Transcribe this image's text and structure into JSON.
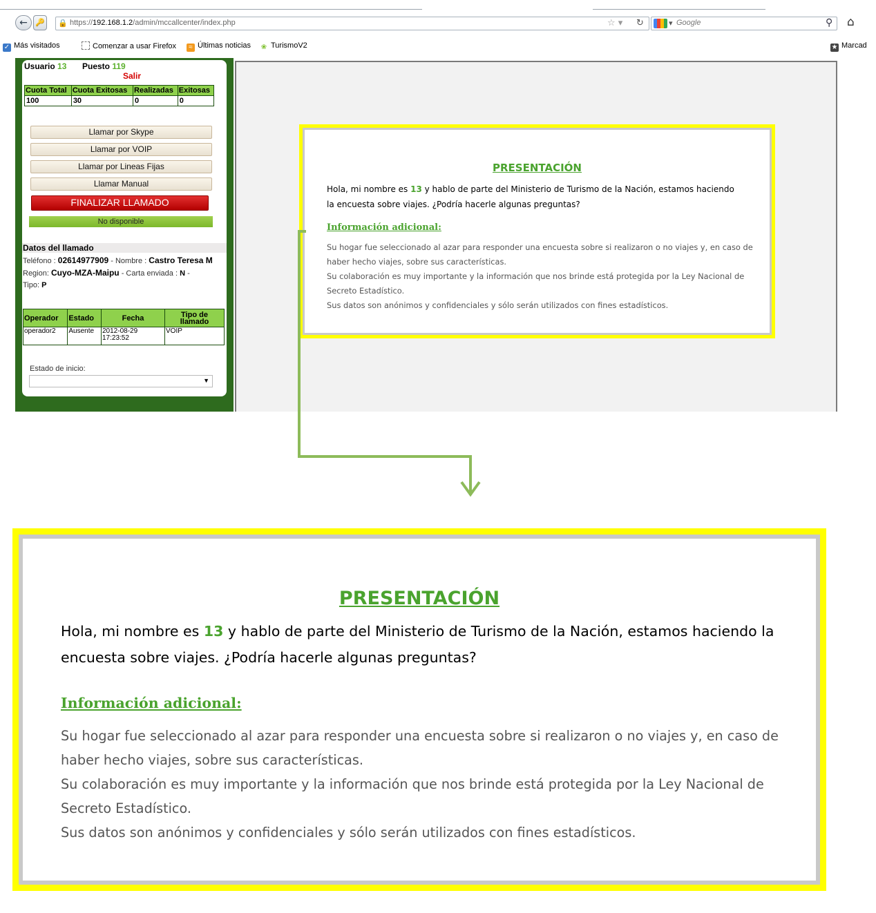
{
  "browser": {
    "back_icon": "back-arrow-icon",
    "url_scheme": "https://",
    "url_host": "192.168.1.2",
    "url_path": "/admin/mccallcenter/index.php",
    "search_placeholder": "Google",
    "bookmarks": [
      "Más visitados",
      "Comenzar a usar Firefox",
      "Últimas noticias",
      "TurismoV2"
    ],
    "bookmarks_right": "Marcad"
  },
  "agent": {
    "usuario_label": "Usuario",
    "usuario_value": "13",
    "puesto_label": "Puesto",
    "puesto_value": "119",
    "salir": "Salir"
  },
  "quota": {
    "headers": [
      "Cuota Total",
      "Cuota Exitosas",
      "Realizadas",
      "Exitosas"
    ],
    "values": [
      "100",
      "30",
      "0",
      "0"
    ]
  },
  "actions": {
    "skype": "Llamar por Skype",
    "voip": "Llamar por VOIP",
    "fijas": "Llamar por Lineas Fijas",
    "manual": "Llamar Manual",
    "finalizar": "FINALIZAR LLAMADO",
    "status": "No disponible"
  },
  "call": {
    "heading": "Datos del llamado",
    "telefono_label": "Teléfono :",
    "telefono": "02614977909",
    "nombre_label": "- Nombre :",
    "nombre": "Castro Teresa M",
    "region_label": "Region:",
    "region": "Cuyo-MZA-Maipu",
    "carta_label": "- Carta enviada :",
    "carta": "N",
    "carta_sep": "-",
    "tipo_label": "Tipo:",
    "tipo": "P",
    "history_headers": [
      "Operador",
      "Estado",
      "Fecha",
      "Tipo de llamado"
    ],
    "history_rows": [
      [
        "operador2",
        "Ausente",
        "2012-08-29 17:23:52",
        "VOIP"
      ]
    ],
    "estado_inicio_label": "Estado de inicio:"
  },
  "presentation": {
    "title": "PRESENTACIÓN",
    "intro_before": "Hola, mi nombre es ",
    "intro_number": "13",
    "intro_after": " y hablo de parte del Ministerio de Turismo de la Nación, estamos haciendo la encuesta sobre viajes. ¿Podría hacerle algunas preguntas?",
    "info_heading": "Información adicional:",
    "info_lines": [
      "Su hogar fue seleccionado al azar para responder una encuesta sobre si realizaron o no viajes y, en caso de haber hecho viajes, sobre sus características.",
      "Su colaboración es muy importante y la información que nos brinde está protegida por la Ley Nacional de Secreto Estadístico.",
      "Sus datos son anónimos y confidenciales y sólo serán utilizados con fines estadísticos."
    ]
  },
  "colors": {
    "accent_green": "#4aa32e",
    "highlight_yellow": "#ffff00",
    "panel_green": "#2e6b1e",
    "danger_red": "#c40000"
  }
}
